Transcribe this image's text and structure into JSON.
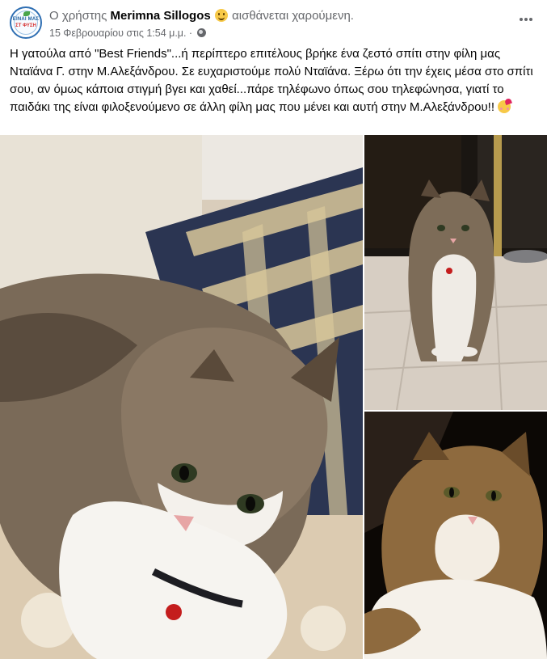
{
  "post": {
    "author_prefix": "Ο χρήστης",
    "author_name": "Merimna Sillogos",
    "feeling": "αισθάνεται χαρούμενη.",
    "feeling_icon": "smiling-face-icon",
    "timestamp": "15 Φεβρουαρίου στις 1:54 μ.μ. ·",
    "audience_icon": "globe-icon",
    "avatar": {
      "line1": "ΕΙΝΑΙ ΜΑΣ",
      "line2": "ΣΤ ΦΥΣΗ"
    },
    "text": "Η γατούλα από \"Best Friends\"...ή περίπτερο επιτέλους βρήκε ένα ζεστό σπίτι στην φίλη μας Νταϊάνα Γ. στην Μ.Αλεξάνδρου. Σε ευχαριστούμε πολύ Νταϊάνα. Ξέρω ότι την έχεις μέσα στο σπίτι σου, αν όμως κάποια στιγμή βγει και χαθεί...πάρε τηλέφωνο όπως σου τηλεφώνησα, γιατί το παιδάκι της είναι φιλοξενούμενο σε άλλη φίλη μας που μένει και αυτή στην Μ.Αλεξάνδρου!!",
    "text_end_icon": "smiling-face-with-hearts-icon"
  },
  "colors": {
    "text_primary": "#050505",
    "text_secondary": "#65676b",
    "background": "#ffffff"
  }
}
